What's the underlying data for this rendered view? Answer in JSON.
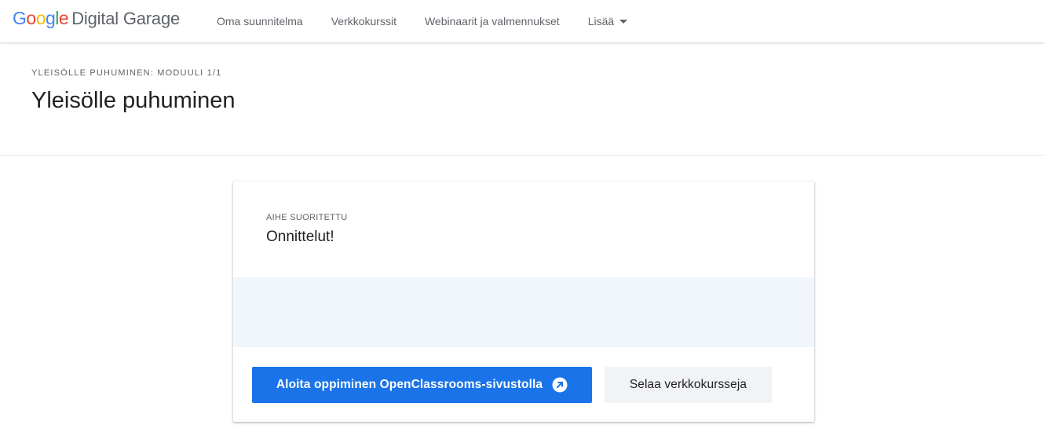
{
  "header": {
    "logo_letters": [
      "G",
      "o",
      "o",
      "g",
      "l",
      "e"
    ],
    "logo_product": "Digital Garage",
    "nav": [
      {
        "label": "Oma suunnitelma"
      },
      {
        "label": "Verkkokurssit"
      },
      {
        "label": "Webinaarit ja valmennukset"
      },
      {
        "label": "Lisää"
      }
    ]
  },
  "hero": {
    "eyebrow": "YLEISÖLLE PUHUMINEN: MODUULI 1/1",
    "title": "Yleisölle puhuminen"
  },
  "card": {
    "eyebrow": "AIHE SUORITETTU",
    "heading": "Onnittelut!",
    "primary_button": "Aloita oppiminen OpenClassrooms-sivustolla",
    "primary_icon": "external-link-icon",
    "secondary_button": "Selaa verkkokursseja"
  },
  "colors": {
    "primary": "#1a73e8",
    "band": "#f1f6fd",
    "secondary_button_bg": "#f1f3f4"
  }
}
